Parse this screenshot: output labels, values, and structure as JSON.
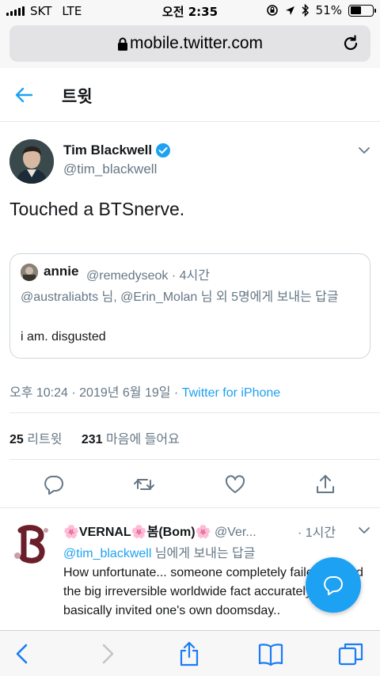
{
  "status_bar": {
    "carrier": "SKT",
    "network": "LTE",
    "time": "오전 2:35",
    "battery_percent": "51%",
    "battery_level": 0.51
  },
  "browser": {
    "url": "mobile.twitter.com"
  },
  "header": {
    "title": "트윗"
  },
  "tweet": {
    "author_name": "Tim Blackwell",
    "author_handle": "@tim_blackwell",
    "text": "Touched a BTSnerve.",
    "quote": {
      "name": "annie",
      "handle_time": "@remedyseok · 4시간",
      "reply_to": "@australiabts 님, @Erin_Molan 님 외 5명에게 보내는 답글",
      "text": "i am. disgusted"
    },
    "meta_date": "오후 10:24 · 2019년 6월 19일 · ",
    "source": "Twitter for iPhone",
    "retweets_count": "25",
    "retweets_label": "리트윗",
    "likes_count": "231",
    "likes_label": "마음에 들어요"
  },
  "reply": {
    "name": "🌸VERNAL🌸봄(Bom)🌸",
    "handle": "@Ver...",
    "time": "· 1시간",
    "reply_to_handle": "@tim_blackwell",
    "reply_to_suffix": " 님에게 보내는 답글",
    "text": "How unfortunate... someone completely failed to read the big irreversible worldwide fact accurately and basically invited one's own doomsday.."
  },
  "colors": {
    "accent": "#1da1f2",
    "muted": "#657786"
  }
}
